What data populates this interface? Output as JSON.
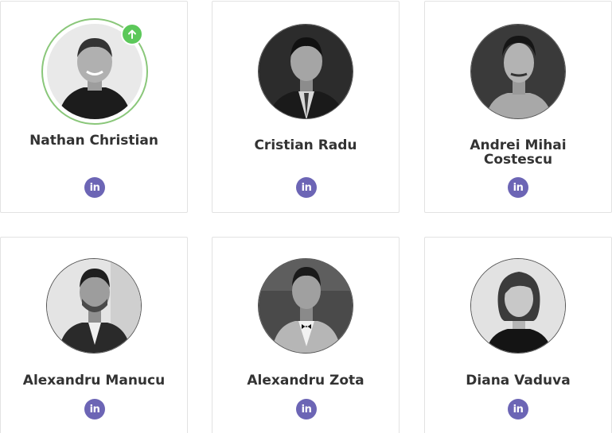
{
  "colors": {
    "linkedin_badge": "#6c65b5",
    "online_ring": "#8ac77a",
    "upload_badge": "#5cc85a",
    "name_text": "#333333",
    "card_border": "#e2e2e2"
  },
  "team": [
    {
      "name": "Nathan Christian",
      "linkedin_icon": "linkedin-icon",
      "linkedin_label": "in",
      "highlight_icon": "arrow-up-icon"
    },
    {
      "name": "Cristian Radu",
      "linkedin_icon": "linkedin-icon",
      "linkedin_label": "in"
    },
    {
      "name": "Andrei Mihai Costescu",
      "linkedin_icon": "linkedin-icon",
      "linkedin_label": "in"
    },
    {
      "name": "Alexandru Manucu",
      "linkedin_icon": "linkedin-icon",
      "linkedin_label": "in"
    },
    {
      "name": "Alexandru Zota",
      "linkedin_icon": "linkedin-icon",
      "linkedin_label": "in"
    },
    {
      "name": "Diana Vaduva",
      "linkedin_icon": "linkedin-icon",
      "linkedin_label": "in"
    }
  ]
}
